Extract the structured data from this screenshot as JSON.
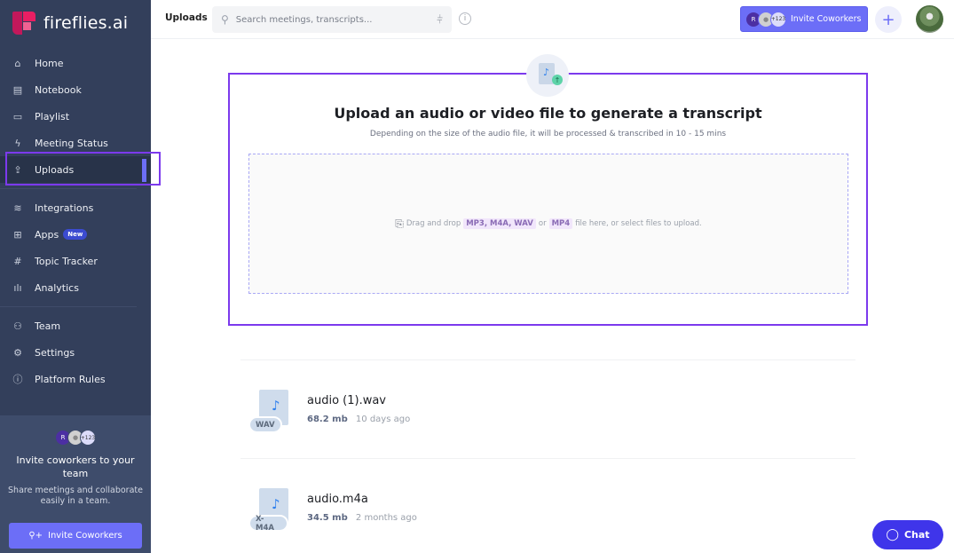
{
  "app": {
    "name": "fireflies.ai"
  },
  "sidebar": {
    "groups": [
      [
        {
          "label": "Home",
          "icon": "home-icon",
          "glyph": "⌂"
        },
        {
          "label": "Notebook",
          "icon": "notebook-icon",
          "glyph": "▤"
        },
        {
          "label": "Playlist",
          "icon": "playlist-icon",
          "glyph": "▭"
        },
        {
          "label": "Meeting Status",
          "icon": "lightning-icon",
          "glyph": "ϟ"
        },
        {
          "label": "Uploads",
          "icon": "upload-icon",
          "glyph": "⇪",
          "active": true
        }
      ],
      [
        {
          "label": "Integrations",
          "icon": "layers-icon",
          "glyph": "≋"
        },
        {
          "label": "Apps",
          "icon": "apps-grid-icon",
          "glyph": "⊞",
          "badge": "New"
        },
        {
          "label": "Topic Tracker",
          "icon": "hash-icon",
          "glyph": "#"
        },
        {
          "label": "Analytics",
          "icon": "bar-chart-icon",
          "glyph": "ılı"
        }
      ],
      [
        {
          "label": "Team",
          "icon": "team-icon",
          "glyph": "⚇"
        },
        {
          "label": "Settings",
          "icon": "gear-icon",
          "glyph": "⚙"
        },
        {
          "label": "Platform Rules",
          "icon": "info-icon",
          "glyph": "ⓘ"
        }
      ]
    ],
    "invite": {
      "avatar_initial": "R",
      "avatar_count": "+123",
      "title": "Invite coworkers to your team",
      "subtitle": "Share meetings and collaborate easily in a team.",
      "button_label": "Invite Coworkers"
    }
  },
  "topbar": {
    "page_title": "Uploads",
    "search_placeholder": "Search meetings, transcripts...",
    "invite_avatar_initial": "R",
    "invite_avatar_count": "+123",
    "invite_label": "Invite Coworkers",
    "plus_label": "+"
  },
  "upload": {
    "title": "Upload an audio or video file to generate a transcript",
    "subtitle": "Depending on the size of the audio file, it will be processed & transcribed in 10 - 15 mins",
    "drop_prefix": "Drag and drop",
    "formats_primary": "MP3, M4A, WAV",
    "or": "or",
    "formats_secondary": "MP4",
    "drop_suffix": "file here, or select files to upload."
  },
  "files": [
    {
      "name": "audio (1).wav",
      "size": "68.2 mb",
      "date": "10 days ago",
      "tag": "WAV"
    },
    {
      "name": "audio.m4a",
      "size": "34.5 mb",
      "date": "2 months ago",
      "tag": "X-M4A"
    }
  ],
  "chat": {
    "label": "Chat"
  },
  "colors": {
    "accent": "#6c6ef7",
    "sidebar": "#333f5b",
    "highlight": "#7c3aed",
    "chat": "#3f35ea"
  }
}
